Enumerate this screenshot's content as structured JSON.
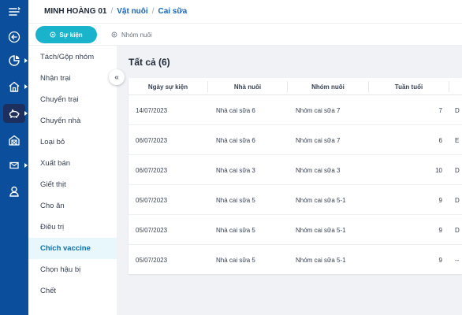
{
  "breadcrumb": {
    "farm": "MINH HOÀNG 01",
    "sep1": "/",
    "section": "Vật nuôi",
    "sep2": "/",
    "page": "Cai sữa"
  },
  "tabs": {
    "event": "Sự kiện",
    "group": "Nhóm nuôi"
  },
  "menu": [
    "Tách/Gộp nhóm",
    "Nhận trại",
    "Chuyển trại",
    "Chuyển nhà",
    "Loại bỏ",
    "Xuất bán",
    "Giết thịt",
    "Cho ăn",
    "Điều trị",
    "Chích vaccine",
    "Chọn hậu bị",
    "Chết"
  ],
  "menu_active": "Chích vaccine",
  "collapse_glyph": "«",
  "content": {
    "title": "Tất cả (6)"
  },
  "table": {
    "columns": [
      "Ngày sự kiện",
      "Nhà nuôi",
      "Nhóm nuôi",
      "Tuần tuổi"
    ],
    "rows": [
      {
        "date": "14/07/2023",
        "house": "Nhà cai sữa 6",
        "group": "Nhóm cai sữa 7",
        "week": "7",
        "extra": "D"
      },
      {
        "date": "06/07/2023",
        "house": "Nhà cai sữa 6",
        "group": "Nhóm cai sữa 7",
        "week": "6",
        "extra": "E"
      },
      {
        "date": "06/07/2023",
        "house": "Nhà cai sữa 3",
        "group": "Nhóm cai sữa 3",
        "week": "10",
        "extra": "D"
      },
      {
        "date": "05/07/2023",
        "house": "Nhà cai sữa 5",
        "group": "Nhóm cai sữa 5-1",
        "week": "9",
        "extra": "D"
      },
      {
        "date": "05/07/2023",
        "house": "Nhà cai sữa 5",
        "group": "Nhóm cai sữa 5-1",
        "week": "9",
        "extra": "D"
      },
      {
        "date": "05/07/2023",
        "house": "Nhà cai sữa 5",
        "group": "Nhóm cai sữa 5-1",
        "week": "9",
        "extra": "--"
      }
    ]
  },
  "colors": {
    "rail": "#0b4f9c",
    "accent": "#19b4cc",
    "link": "#1565c0",
    "active_menu_bg": "#e8f7fb"
  },
  "rail_icons": [
    "menu-toggle-icon",
    "back-arrow-icon",
    "pie-chart-icon",
    "home-icon",
    "pig-icon",
    "barn-icon",
    "mail-icon",
    "user-icon"
  ]
}
